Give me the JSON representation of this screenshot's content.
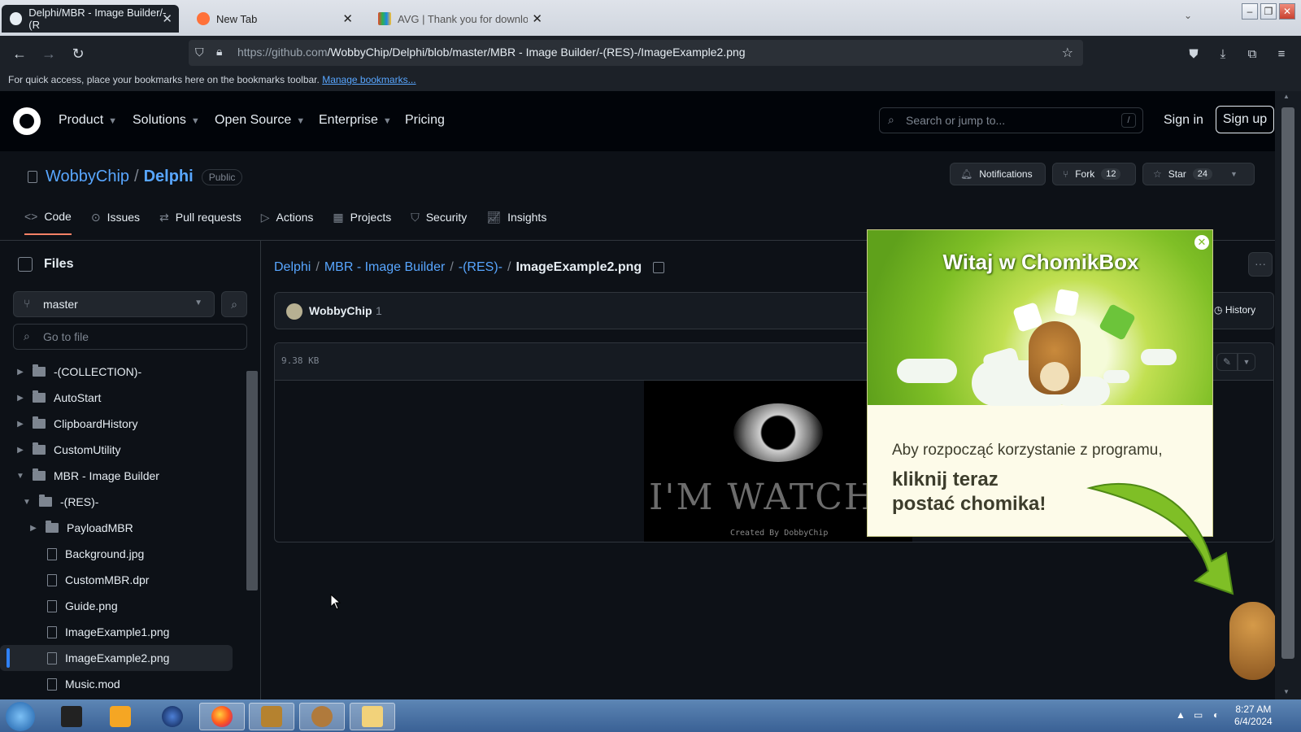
{
  "browser": {
    "tabs": [
      {
        "title": "Delphi/MBR - Image Builder/-(R",
        "active": true
      },
      {
        "title": "New Tab",
        "active": false
      },
      {
        "title": "AVG | Thank you for downloadi",
        "active": false
      }
    ],
    "url_prefix": "https://github.com",
    "url_path": "/WobbyChip/Delphi/blob/master/MBR - Image Builder/-(RES)-/ImageExample2.png",
    "bookmarks_text": "For quick access, place your bookmarks here on the bookmarks toolbar.",
    "bookmarks_link": "Manage bookmarks..."
  },
  "github": {
    "nav": [
      "Product",
      "Solutions",
      "Open Source",
      "Enterprise",
      "Pricing"
    ],
    "search_placeholder": "Search or jump to...",
    "search_key": "/",
    "sign_in": "Sign in",
    "sign_up": "Sign up"
  },
  "repo": {
    "owner": "WobbyChip",
    "name": "Delphi",
    "visibility": "Public",
    "notifications": "Notifications",
    "fork_label": "Fork",
    "fork_count": "12",
    "star_label": "Star",
    "star_count": "24",
    "tabs": [
      "Code",
      "Issues",
      "Pull requests",
      "Actions",
      "Projects",
      "Security",
      "Insights"
    ]
  },
  "sidebar": {
    "title": "Files",
    "branch": "master",
    "goto_placeholder": "Go to file",
    "tree": [
      {
        "name": "-(COLLECTION)-",
        "type": "folder",
        "open": false,
        "depth": 0
      },
      {
        "name": "AutoStart",
        "type": "folder",
        "open": false,
        "depth": 0
      },
      {
        "name": "ClipboardHistory",
        "type": "folder",
        "open": false,
        "depth": 0
      },
      {
        "name": "CustomUtility",
        "type": "folder",
        "open": false,
        "depth": 0
      },
      {
        "name": "MBR - Image Builder",
        "type": "folder",
        "open": true,
        "depth": 0
      },
      {
        "name": "-(RES)-",
        "type": "folder",
        "open": true,
        "depth": 1
      },
      {
        "name": "PayloadMBR",
        "type": "folder",
        "open": false,
        "depth": 2
      },
      {
        "name": "Background.jpg",
        "type": "file",
        "depth": 2
      },
      {
        "name": "CustomMBR.dpr",
        "type": "file",
        "depth": 2
      },
      {
        "name": "Guide.png",
        "type": "file",
        "depth": 2
      },
      {
        "name": "ImageExample1.png",
        "type": "file",
        "depth": 2
      },
      {
        "name": "ImageExample2.png",
        "type": "file",
        "depth": 2,
        "selected": true
      },
      {
        "name": "Music.mod",
        "type": "file",
        "depth": 2
      }
    ]
  },
  "main": {
    "breadcrumb": [
      "Delphi",
      "MBR - Image Builder",
      "-(RES)-"
    ],
    "current_file": "ImageExample2.png",
    "author": "WobbyChip",
    "author_count": "1",
    "history": "History",
    "file_size": "9.38 KB",
    "image_text": "I'M WATCHING YO",
    "image_caption": "Created By DobbyChip"
  },
  "ad": {
    "title": "Witaj w ChomikBox",
    "line1": "Aby rozpocząć korzystanie z programu,",
    "line2": "kliknij teraz\npostać chomika!"
  },
  "taskbar": {
    "time": "8:27 AM",
    "date": "6/4/2024"
  }
}
